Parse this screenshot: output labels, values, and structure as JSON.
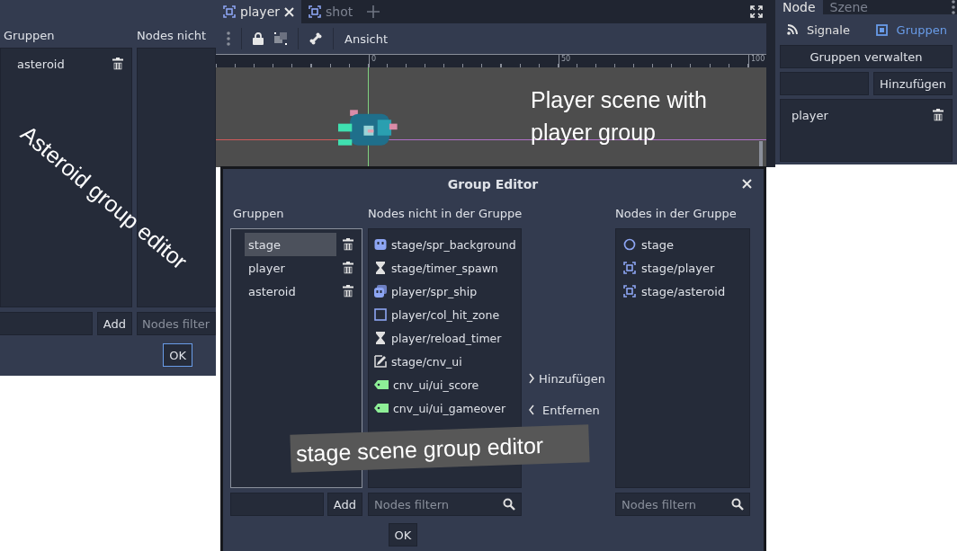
{
  "asteroid_editor": {
    "groups_header": "Gruppen",
    "nodes_header": "Nodes nicht",
    "groups": [
      {
        "label": "asteroid",
        "selected": false
      }
    ],
    "add_button": "Add",
    "filter": {
      "placeholder": "Nodes filter"
    },
    "ok_button": {
      "label": "OK",
      "focused": true
    },
    "annotation": "Asteroid group editor"
  },
  "scene_editor": {
    "tabs": [
      {
        "label": "player",
        "selected": true
      },
      {
        "label": "shot",
        "selected": false
      }
    ],
    "view_menu": "Ansicht",
    "ruler_labels": [
      "0",
      "50",
      "100"
    ],
    "annotation": "Player scene with player group"
  },
  "node_dock": {
    "tabs": [
      {
        "label": "Node",
        "selected": true
      },
      {
        "label": "Szene",
        "selected": false
      }
    ],
    "sections": [
      {
        "label": "Signale",
        "kind": "signals",
        "selected": false
      },
      {
        "label": "Gruppen",
        "kind": "groups",
        "selected": true
      }
    ],
    "manage_button": "Gruppen verwalten",
    "add_button": "Hinzufügen",
    "groups": [
      {
        "label": "player",
        "selected": false
      }
    ]
  },
  "group_editor": {
    "title": "Group Editor",
    "groups_header": "Gruppen",
    "outside_header": "Nodes nicht in der Gruppe",
    "inside_header": "Nodes in der Gruppe",
    "groups": [
      {
        "label": "stage",
        "selected": true
      },
      {
        "label": "player",
        "selected": false
      },
      {
        "label": "asteroid",
        "selected": false
      }
    ],
    "outside_nodes": [
      {
        "label": "stage/spr_background",
        "kind": "sprite"
      },
      {
        "label": "stage/timer_spawn",
        "kind": "timer"
      },
      {
        "label": "player/spr_ship",
        "kind": "stacked"
      },
      {
        "label": "player/col_hit_zone",
        "kind": "shape"
      },
      {
        "label": "player/reload_timer",
        "kind": "timer"
      },
      {
        "label": "stage/cnv_ui",
        "kind": "canvas"
      },
      {
        "label": "cnv_ui/ui_score",
        "kind": "label"
      },
      {
        "label": "cnv_ui/ui_gameover",
        "kind": "label"
      }
    ],
    "add_button": "Hinzufügen",
    "remove_button": "Entfernen",
    "inside_nodes": [
      {
        "label": "stage",
        "kind": "node"
      },
      {
        "label": "stage/player",
        "kind": "scene"
      },
      {
        "label": "stage/asteroid",
        "kind": "scene"
      }
    ],
    "add_group_button": "Add",
    "outside_filter": {
      "placeholder": "Nodes filtern"
    },
    "inside_filter": {
      "placeholder": "Nodes filtern"
    },
    "ok_button": {
      "label": "OK",
      "focused": false
    },
    "annotation": "stage scene group editor"
  }
}
